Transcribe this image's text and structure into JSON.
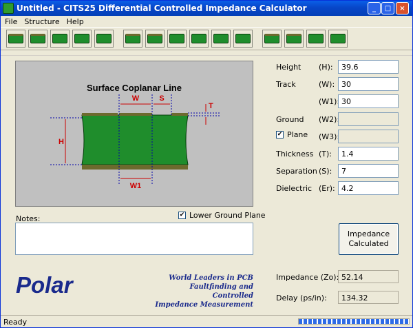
{
  "window": {
    "title": "Untitled - CITS25 Differential Controlled Impedance Calculator",
    "minimize": "_",
    "maximize": "□",
    "close": "×"
  },
  "menu": [
    "File",
    "Structure",
    "Help"
  ],
  "diagram": {
    "title": "Surface Coplanar Line",
    "labels": {
      "w": "W",
      "s": "S",
      "t": "T",
      "h": "H",
      "w1": "W1"
    }
  },
  "lower_ground": {
    "label": "Lower Ground Plane",
    "checked": "✔"
  },
  "notes": {
    "label": "Notes:"
  },
  "logo": {
    "text": "Polar",
    "tagline": [
      "World Leaders in PCB",
      "Faultfinding and Controlled",
      "Impedance Measurement"
    ]
  },
  "fields": {
    "height": {
      "label": "Height",
      "sym": "(H):",
      "value": "39.6"
    },
    "track": {
      "label": "Track",
      "sym": "(W):",
      "value": "30"
    },
    "track1": {
      "sym": "(W1):",
      "value": "30"
    },
    "ground": {
      "label": "Ground",
      "sym": "(W2):",
      "value": ""
    },
    "plane": {
      "label": "Plane",
      "sym": "(W3):",
      "value": "",
      "checked": "✔"
    },
    "thickness": {
      "label": "Thickness",
      "sym": "(T):",
      "value": "1.4"
    },
    "separation": {
      "label": "Separation",
      "sym": "(S):",
      "value": "7"
    },
    "dielectric": {
      "label": "Dielectric",
      "sym": "(Er):",
      "value": "4.2"
    }
  },
  "calc_button": {
    "line1": "Impedance",
    "line2": "Calculated"
  },
  "results": {
    "impedance": {
      "label": "Impedance (Zo):",
      "value": "52.14"
    },
    "delay": {
      "label": "Delay (ps/in):",
      "value": "134.32"
    }
  },
  "status": {
    "text": "Ready"
  },
  "colors": {
    "substrate": "#1f8d2c",
    "copper": "#6d6a2e",
    "dimension": "#cc0000"
  }
}
